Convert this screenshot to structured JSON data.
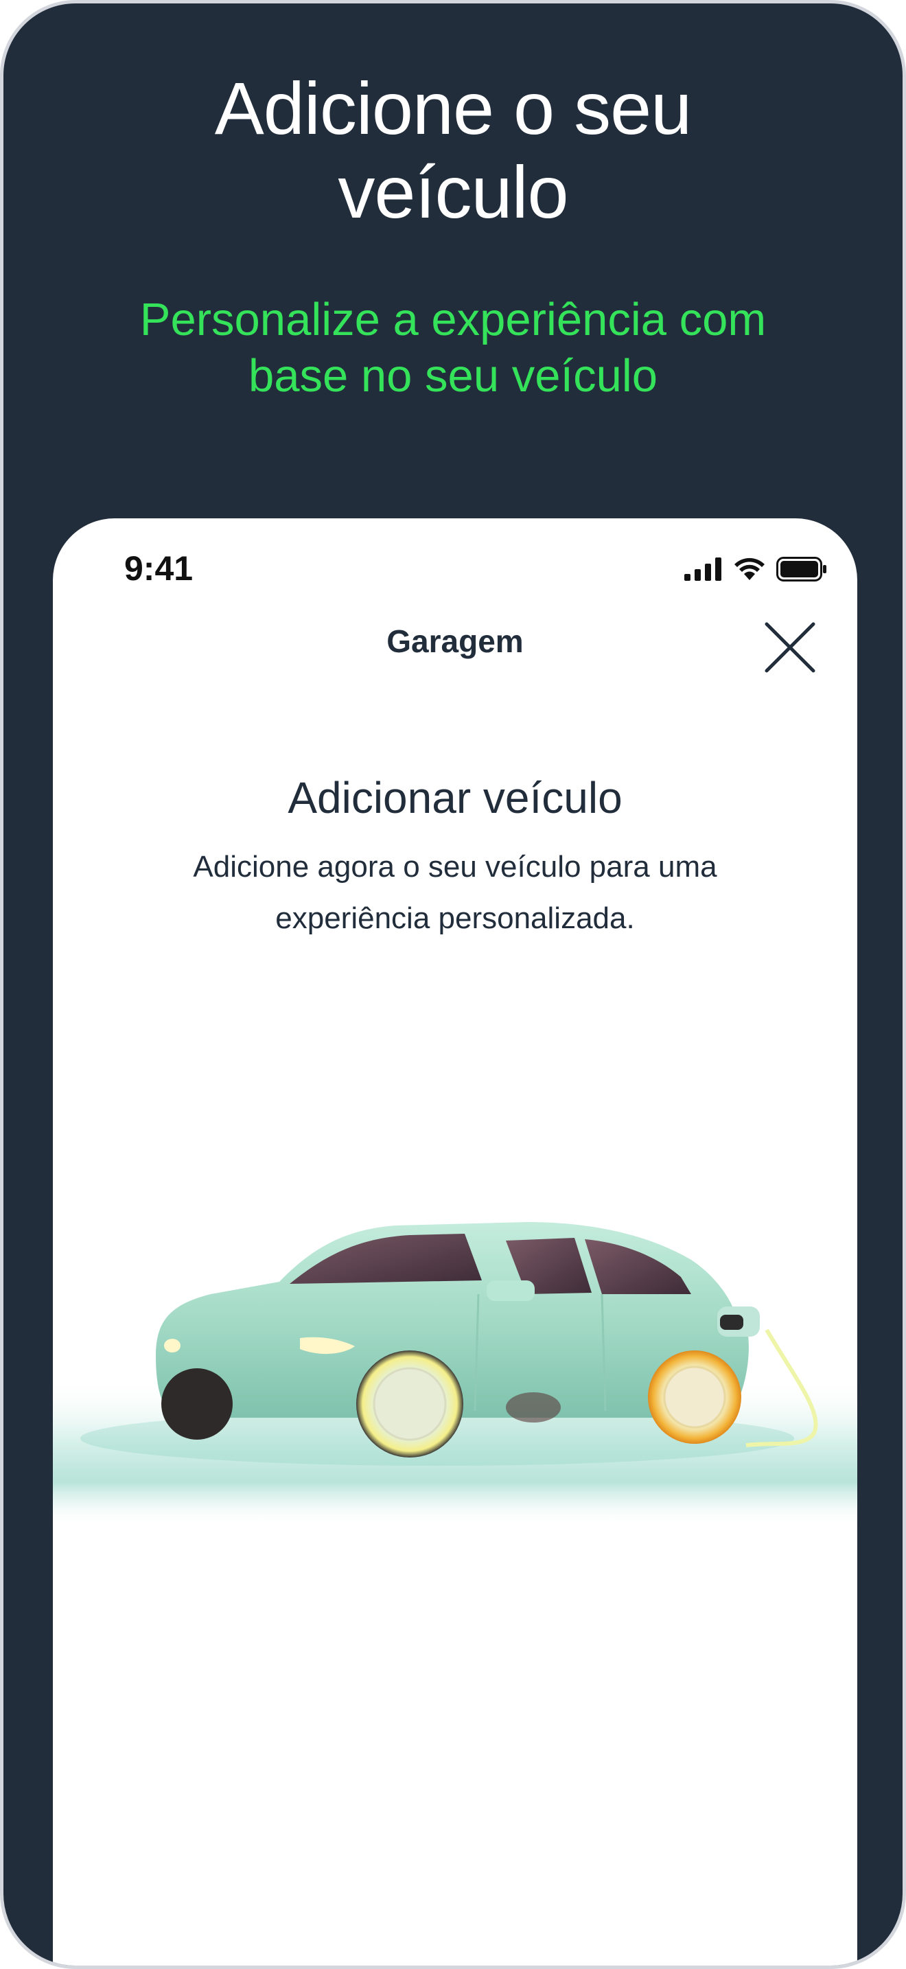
{
  "hero": {
    "title_line1": "Adicione o seu",
    "title_line2": "veículo",
    "subtitle_line1": "Personalize a experiência com",
    "subtitle_line2": "base no seu veículo"
  },
  "status_bar": {
    "time": "9:41",
    "icons": [
      "cellular-signal-icon",
      "wifi-icon",
      "battery-icon"
    ]
  },
  "nav": {
    "title": "Garagem",
    "close_icon": "close-icon"
  },
  "content": {
    "title": "Adicionar veículo",
    "description_line1": "Adicione agora o seu veículo para uma",
    "description_line2": "experiência personalizada."
  },
  "illustration": {
    "name": "electric-car-charging"
  },
  "colors": {
    "background": "#222d3c",
    "accent": "#34e35a",
    "screen": "#ffffff",
    "text_dark": "#222d3c",
    "car": "#a8dcc8"
  }
}
